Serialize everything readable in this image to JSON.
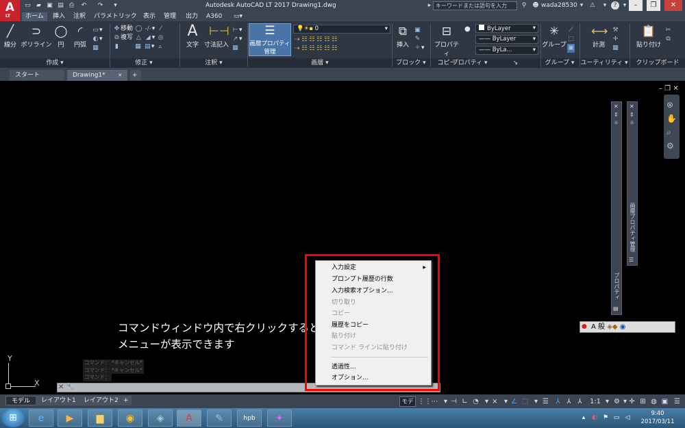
{
  "app": {
    "logo_letter": "A",
    "logo_sub": "LT",
    "title": "Autodesk AutoCAD LT 2017    Drawing1.dwg",
    "search_placeholder": "キーワードまたは語句を入力",
    "user": "wada28530"
  },
  "ribbon_tabs": [
    "ホーム",
    "挿入",
    "注釈",
    "パラメトリック",
    "表示",
    "管理",
    "出力",
    "A360"
  ],
  "ribbon": {
    "draw": {
      "line": "線分",
      "polyline": "ポリライン",
      "circle": "円",
      "arc": "円弧",
      "title": "作成"
    },
    "modify": {
      "move": "移動",
      "copy": "複写",
      "title": "修正"
    },
    "annotation": {
      "text": "文字",
      "dimension": "寸法記入",
      "title": "注釈"
    },
    "layers": {
      "properties_line1": "画層プロパティ",
      "properties_line2": "管理",
      "current_layer": "0",
      "title": "画層"
    },
    "block": {
      "insert": "挿入",
      "title": "ブロック"
    },
    "properties": {
      "match_line1": "プロパティ",
      "match_line2": "コピー",
      "color": "ByLayer",
      "linetype": "ByLayer",
      "lineweight": "ByLa...",
      "title": "プロパティ"
    },
    "groups": {
      "group": "グループ",
      "title": "グループ"
    },
    "utilities": {
      "measure": "計測",
      "title": "ユーティリティ"
    },
    "clipboard": {
      "paste": "貼り付け",
      "title": "クリップボード"
    }
  },
  "doc_tabs": [
    "スタート",
    "Drawing1*"
  ],
  "palettes": {
    "properties": "プロパティ",
    "layer_manager": "画層プロパティ管理"
  },
  "annotation": {
    "line1": "コマンドウィンドウ内で右クリックすると",
    "line2": "メニューが表示できます"
  },
  "command_history": [
    "コマンド： *キャンセル*",
    "コマンド： *キャンセル*",
    "コマンド："
  ],
  "ucs": {
    "x": "X",
    "y": "Y"
  },
  "context_menu": {
    "items": [
      {
        "label": "入力設定",
        "enabled": true,
        "submenu": true
      },
      {
        "label": "プロンプト履歴の行数",
        "enabled": true
      },
      {
        "label": "入力検索オプション...",
        "enabled": true
      },
      {
        "label": "切り取り",
        "enabled": false
      },
      {
        "label": "コピー",
        "enabled": false
      },
      {
        "label": "履歴をコピー",
        "enabled": true
      },
      {
        "label": "貼り付け",
        "enabled": false
      },
      {
        "label": "コマンド ラインに貼り付け",
        "enabled": false
      },
      {
        "label": "透過性...",
        "enabled": true
      },
      {
        "label": "オプション...",
        "enabled": true
      }
    ]
  },
  "layout_tabs": [
    "モデル",
    "レイアウト1",
    "レイアウト2"
  ],
  "status": {
    "model": "モデル",
    "scale": "1:1"
  },
  "ime": {
    "mode": "A 般"
  },
  "taskbar": {
    "time": "9:40",
    "date": "2017/03/11"
  },
  "colors": {
    "highlight_box": "#ff0000",
    "ribbon_bg": "#2f3744",
    "layer_button": "#4a73a8"
  }
}
